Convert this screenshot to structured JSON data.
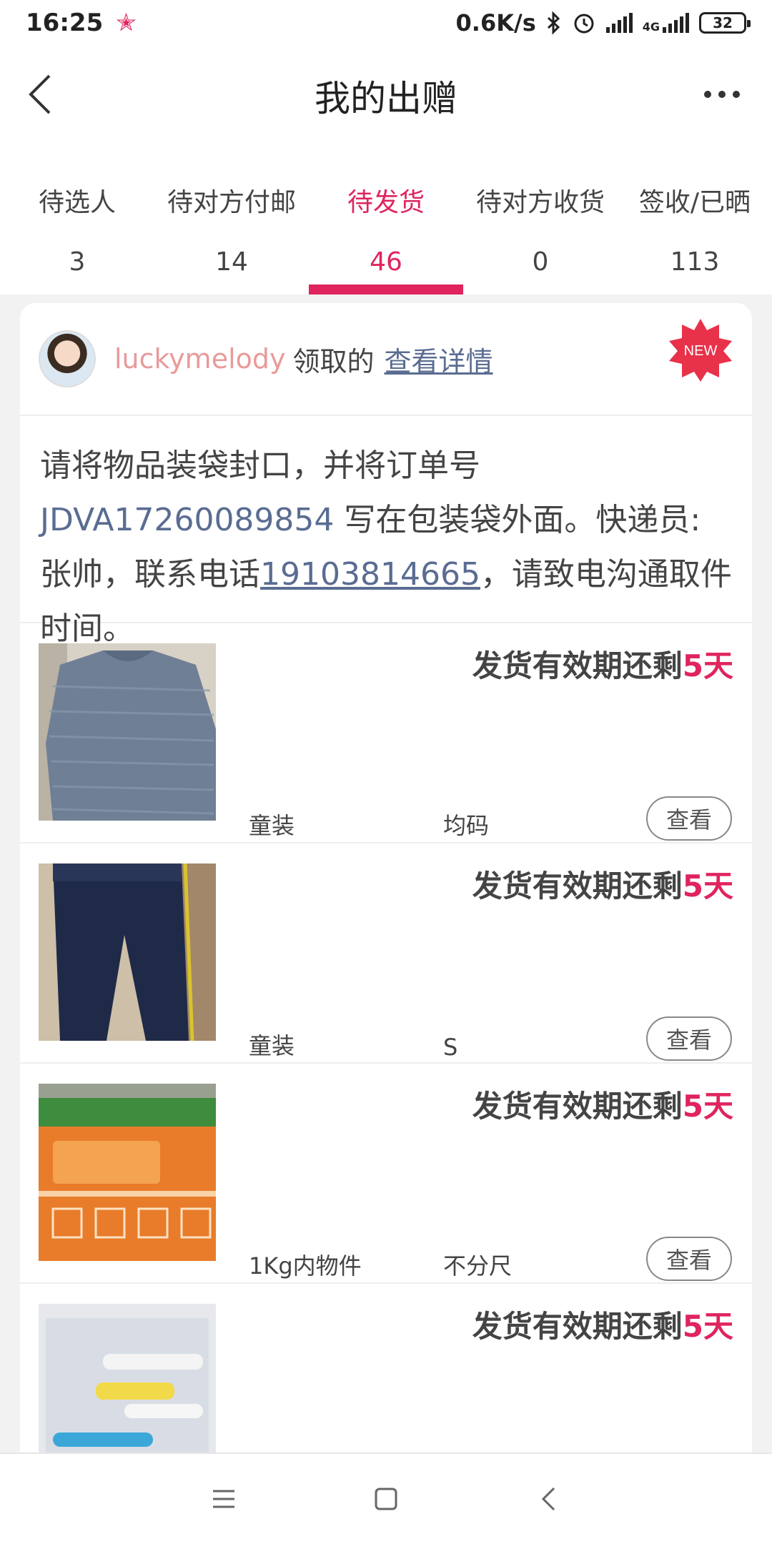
{
  "status_bar": {
    "time": "16:25",
    "net_speed": "0.6K/s",
    "network_type": "4G",
    "battery": "32",
    "icons": [
      "star-icon",
      "bluetooth-icon",
      "alarm-icon",
      "signal-icon",
      "signal-4g-icon",
      "battery-icon"
    ]
  },
  "header": {
    "title": "我的出赠",
    "back_icon": "chevron-left-icon",
    "more_icon": "more-dots-icon"
  },
  "tabs": [
    {
      "label": "待选人",
      "count": "3",
      "active": false
    },
    {
      "label": "待对方付邮",
      "count": "14",
      "active": false
    },
    {
      "label": "待发货",
      "count": "46",
      "active": true
    },
    {
      "label": "待对方收货",
      "count": "0",
      "active": false
    },
    {
      "label": "签收/已晒",
      "count": "113",
      "active": false
    }
  ],
  "card": {
    "user_name": "luckymelody",
    "claim_text": "领取的",
    "detail_link": "查看详情",
    "badge": "NEW",
    "instructions": {
      "part1": "请将物品装袋封口，并将订单号 ",
      "order_no": "JDVA17260089854",
      "part2": " 写在包装袋外面。快递员:张帅，联系电话",
      "phone": "19103814665",
      "part3": "，请致电沟通取件时间。"
    }
  },
  "items": [
    {
      "expiry_prefix": "发货有效期还剩",
      "expiry_days": "5天",
      "category": "童装",
      "size": "均码",
      "view_label": "查看"
    },
    {
      "expiry_prefix": "发货有效期还剩",
      "expiry_days": "5天",
      "category": "童装",
      "size": "S",
      "view_label": "查看"
    },
    {
      "expiry_prefix": "发货有效期还剩",
      "expiry_days": "5天",
      "category": "1Kg内物件",
      "size": "不分尺",
      "view_label": "查看"
    },
    {
      "expiry_prefix": "发货有效期还剩",
      "expiry_days": "5天",
      "category": "",
      "size": "",
      "view_label": ""
    }
  ],
  "colors": {
    "accent": "#e0245e",
    "link": "#5a6c91",
    "username": "#e99a9a"
  },
  "nav_bar": {
    "icons": [
      "menu-icon",
      "home-square-icon",
      "back-triangle-icon"
    ]
  }
}
